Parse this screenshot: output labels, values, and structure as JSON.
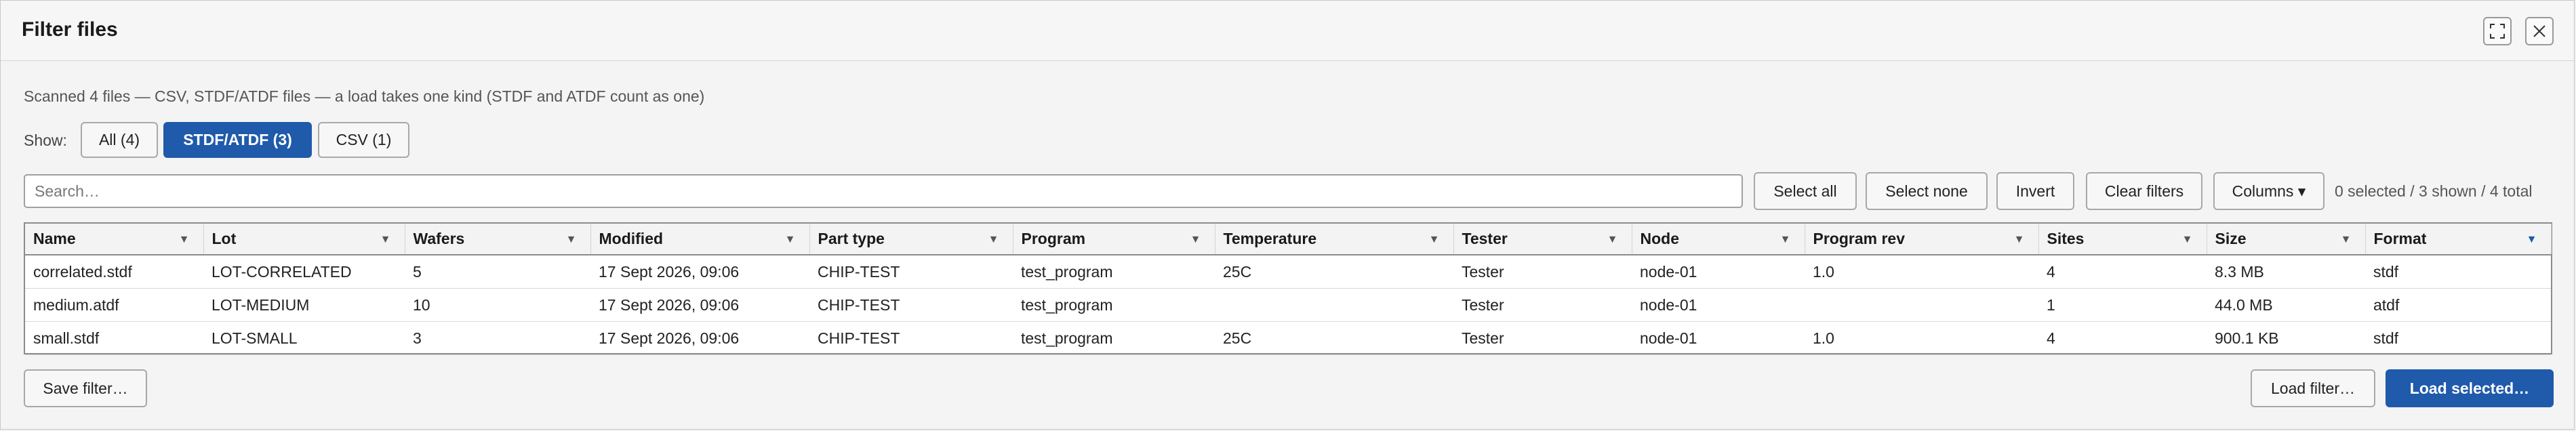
{
  "dialog": {
    "title": "Filter files",
    "subtitle": "Scanned 4 files — CSV, STDF/ATDF files — a load takes one kind (STDF and ATDF count as one)"
  },
  "show": {
    "label": "Show:",
    "options": [
      {
        "label": "All (4)",
        "active": false
      },
      {
        "label": "STDF/ATDF (3)",
        "active": true
      },
      {
        "label": "CSV (1)",
        "active": false
      }
    ]
  },
  "toolbar": {
    "search_placeholder": "Search…",
    "select_all": "Select all",
    "select_none": "Select none",
    "invert": "Invert",
    "clear_filters": "Clear filters",
    "columns": "Columns ▾",
    "count": "0 selected / 3 shown / 4 total"
  },
  "table": {
    "columns": [
      "Name",
      "Lot",
      "Wafers",
      "Modified",
      "Part type",
      "Program",
      "Temperature",
      "Tester",
      "Node",
      "Program rev",
      "Sites",
      "Size",
      "Format"
    ],
    "rows": [
      [
        "correlated.stdf",
        "LOT-CORRELATED",
        "5",
        "17 Sept 2026, 09:06",
        "CHIP-TEST",
        "test_program",
        "25C",
        "Tester",
        "node-01",
        "1.0",
        "4",
        "8.3 MB",
        "stdf"
      ],
      [
        "medium.atdf",
        "LOT-MEDIUM",
        "10",
        "17 Sept 2026, 09:06",
        "CHIP-TEST",
        "test_program",
        "",
        "Tester",
        "node-01",
        "",
        "1",
        "44.0 MB",
        "atdf"
      ],
      [
        "small.stdf",
        "LOT-SMALL",
        "3",
        "17 Sept 2026, 09:06",
        "CHIP-TEST",
        "test_program",
        "25C",
        "Tester",
        "node-01",
        "1.0",
        "4",
        "900.1 KB",
        "stdf"
      ]
    ],
    "active_filter_column": "Format"
  },
  "footer": {
    "save_filter": "Save filter…",
    "load_filter": "Load filter…",
    "load_selected": "Load selected…"
  },
  "colors": {
    "accent": "#1f5aab"
  }
}
